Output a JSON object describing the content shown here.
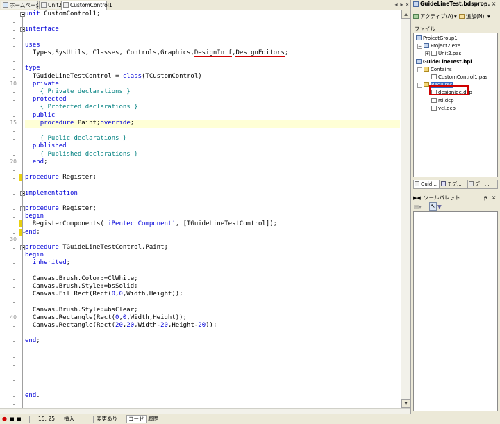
{
  "editor_tabs": [
    {
      "label": "ホームページ",
      "active": false
    },
    {
      "label": "Unit2",
      "active": false
    },
    {
      "label": "CustomControl1",
      "active": true
    }
  ],
  "line_numbers": [
    "10",
    "15",
    "20",
    "30",
    "40"
  ],
  "code_lines": [
    [
      {
        "t": "unit",
        "c": "kw"
      },
      {
        "t": " CustomControl1;",
        "c": "tx"
      }
    ],
    [],
    [
      {
        "t": "interface",
        "c": "kw"
      }
    ],
    [],
    [
      {
        "t": "uses",
        "c": "kw"
      }
    ],
    [
      {
        "t": "  Types,SysUtils, Classes, Controls,Graphics,",
        "c": "tx"
      },
      {
        "t": "DesignIntf",
        "c": "tx",
        "u": true
      },
      {
        "t": ",",
        "c": "tx"
      },
      {
        "t": "DesignEditors",
        "c": "tx",
        "u": true
      },
      {
        "t": ";",
        "c": "tx"
      }
    ],
    [],
    [
      {
        "t": "type",
        "c": "kw"
      }
    ],
    [
      {
        "t": "  TGuideLineTestControl = ",
        "c": "tx"
      },
      {
        "t": "class",
        "c": "kw"
      },
      {
        "t": "(TCustomControl)",
        "c": "tx"
      }
    ],
    [
      {
        "t": "  private",
        "c": "kw"
      }
    ],
    [
      {
        "t": "    { Private declarations }",
        "c": "cm"
      }
    ],
    [
      {
        "t": "  protected",
        "c": "kw"
      }
    ],
    [
      {
        "t": "    { Protected declarations }",
        "c": "cm"
      }
    ],
    [
      {
        "t": "  public",
        "c": "kw"
      }
    ],
    [
      {
        "t": "    ",
        "c": "tx"
      },
      {
        "t": "procedure",
        "c": "kw"
      },
      {
        "t": " Paint;",
        "c": "tx"
      },
      {
        "t": "override",
        "c": "kw"
      },
      {
        "t": ";",
        "c": "tx"
      }
    ],
    [],
    [
      {
        "t": "    { Public declarations }",
        "c": "cm"
      }
    ],
    [
      {
        "t": "  published",
        "c": "kw"
      }
    ],
    [
      {
        "t": "    { Published declarations }",
        "c": "cm"
      }
    ],
    [
      {
        "t": "  end",
        "c": "kw"
      },
      {
        "t": ";",
        "c": "tx"
      }
    ],
    [],
    [
      {
        "t": "procedure",
        "c": "kw"
      },
      {
        "t": " Register;",
        "c": "tx"
      }
    ],
    [],
    [
      {
        "t": "implementation",
        "c": "kw"
      }
    ],
    [],
    [
      {
        "t": "procedure",
        "c": "kw"
      },
      {
        "t": " Register;",
        "c": "tx"
      }
    ],
    [
      {
        "t": "begin",
        "c": "kw"
      }
    ],
    [
      {
        "t": "  RegisterComponents(",
        "c": "tx"
      },
      {
        "t": "'iPentec Component'",
        "c": "st"
      },
      {
        "t": ", [TGuideLineTestControl]);",
        "c": "tx"
      }
    ],
    [
      {
        "t": "end",
        "c": "kw"
      },
      {
        "t": ";",
        "c": "tx"
      }
    ],
    [],
    [
      {
        "t": "procedure",
        "c": "kw"
      },
      {
        "t": " TGuideLineTestControl.Paint;",
        "c": "tx"
      }
    ],
    [
      {
        "t": "begin",
        "c": "kw"
      }
    ],
    [
      {
        "t": "  ",
        "c": "tx"
      },
      {
        "t": "inherited",
        "c": "kw"
      },
      {
        "t": ";",
        "c": "tx"
      }
    ],
    [],
    [
      {
        "t": "  Canvas.Brush.Color:=ClWhite;",
        "c": "tx"
      }
    ],
    [
      {
        "t": "  Canvas.Brush.Style:=bsSolid;",
        "c": "tx"
      }
    ],
    [
      {
        "t": "  Canvas.FillRect(Rect(",
        "c": "tx"
      },
      {
        "t": "0",
        "c": "nm"
      },
      {
        "t": ",",
        "c": "tx"
      },
      {
        "t": "0",
        "c": "nm"
      },
      {
        "t": ",Width,Height));",
        "c": "tx"
      }
    ],
    [],
    [
      {
        "t": "  Canvas.Brush.Style:=bsClear;",
        "c": "tx"
      }
    ],
    [
      {
        "t": "  Canvas.Rectangle(Rect(",
        "c": "tx"
      },
      {
        "t": "0",
        "c": "nm"
      },
      {
        "t": ",",
        "c": "tx"
      },
      {
        "t": "0",
        "c": "nm"
      },
      {
        "t": ",Width,Height));",
        "c": "tx"
      }
    ],
    [
      {
        "t": "  Canvas.Rectangle(Rect(",
        "c": "tx"
      },
      {
        "t": "20",
        "c": "nm"
      },
      {
        "t": ",",
        "c": "tx"
      },
      {
        "t": "20",
        "c": "nm"
      },
      {
        "t": ",Width-",
        "c": "tx"
      },
      {
        "t": "20",
        "c": "nm"
      },
      {
        "t": ",Height-",
        "c": "tx"
      },
      {
        "t": "20",
        "c": "nm"
      },
      {
        "t": "));",
        "c": "tx"
      }
    ],
    [],
    [
      {
        "t": "end",
        "c": "kw"
      },
      {
        "t": ";",
        "c": "tx"
      }
    ],
    [],
    [],
    [],
    [],
    [],
    [],
    [
      {
        "t": "end",
        "c": "kw"
      },
      {
        "t": ".",
        "c": "tx"
      }
    ]
  ],
  "status": {
    "position": "15: 25",
    "mode": "挿入",
    "modified": "変更あり",
    "tab_code": "コード",
    "tab_history": "履歴"
  },
  "project_manager": {
    "title": "GuideLineTest.bdspro...",
    "pin": "ᵽ",
    "close": "×",
    "activate_label": "アクティブ(A)",
    "add_label": "追加(N)",
    "header": "ファイル",
    "tree": [
      {
        "label": "ProjectGroup1",
        "icon": "project-group-icon",
        "level": 0
      },
      {
        "label": "Project2.exe",
        "icon": "exe-icon",
        "level": 1,
        "expander": "−"
      },
      {
        "label": "Unit2.pas",
        "icon": "pas-file-icon",
        "level": 2,
        "expander": "+"
      },
      {
        "label": "GuideLineTest.bpl",
        "icon": "package-icon",
        "level": 0,
        "bold": true
      },
      {
        "label": "Contains",
        "icon": "folder-icon",
        "level": 1,
        "expander": "−"
      },
      {
        "label": "CustomControl1.pas",
        "icon": "pas-file-icon",
        "level": 2
      },
      {
        "label": "Requires",
        "icon": "folder-icon",
        "level": 1,
        "expander": "−",
        "selected": true
      },
      {
        "label": "designide.dcp",
        "icon": "dcp-file-icon",
        "level": 2,
        "highlighted": true
      },
      {
        "label": "rtl.dcp",
        "icon": "dcp-file-icon",
        "level": 2
      },
      {
        "label": "vcl.dcp",
        "icon": "dcp-file-icon",
        "level": 2
      }
    ],
    "bottom_tabs": [
      "Guid...",
      "モデ...",
      "デー..."
    ]
  },
  "tool_palette": {
    "title": "ツールパレット",
    "pin": "ᵽ",
    "close": "×"
  }
}
